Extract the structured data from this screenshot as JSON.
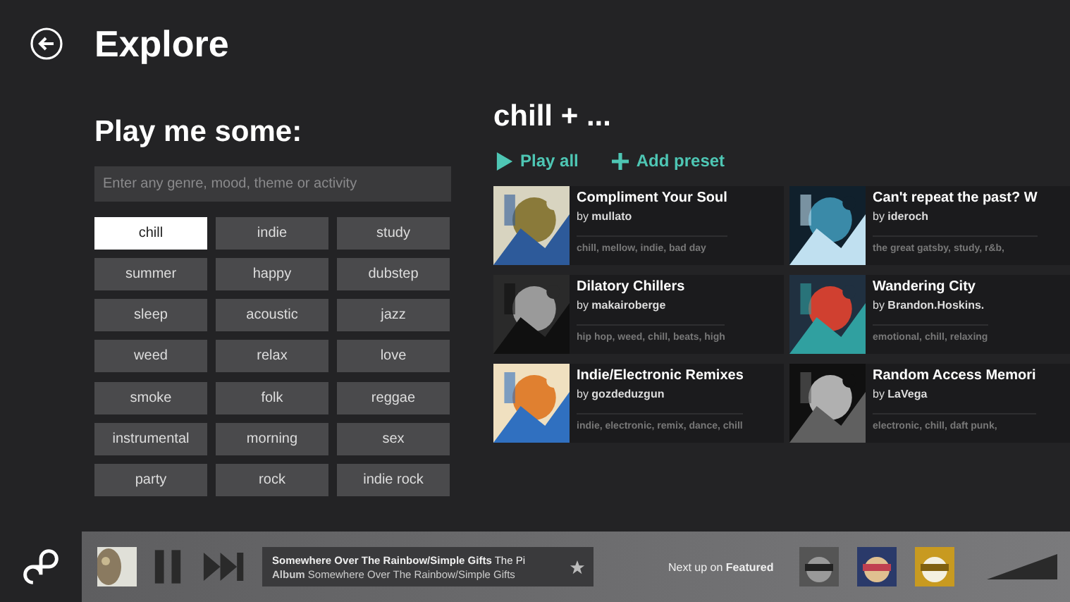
{
  "header": {
    "title": "Explore"
  },
  "search": {
    "heading": "Play me some:",
    "placeholder": "Enter any genre, mood, theme or activity"
  },
  "tags": [
    {
      "label": "chill",
      "selected": true
    },
    {
      "label": "indie",
      "selected": false
    },
    {
      "label": "study",
      "selected": false
    },
    {
      "label": "summer",
      "selected": false
    },
    {
      "label": "happy",
      "selected": false
    },
    {
      "label": "dubstep",
      "selected": false
    },
    {
      "label": "sleep",
      "selected": false
    },
    {
      "label": "acoustic",
      "selected": false
    },
    {
      "label": "jazz",
      "selected": false
    },
    {
      "label": "weed",
      "selected": false
    },
    {
      "label": "relax",
      "selected": false
    },
    {
      "label": "love",
      "selected": false
    },
    {
      "label": "smoke",
      "selected": false
    },
    {
      "label": "folk",
      "selected": false
    },
    {
      "label": "reggae",
      "selected": false
    },
    {
      "label": "instrumental",
      "selected": false
    },
    {
      "label": "morning",
      "selected": false
    },
    {
      "label": "sex",
      "selected": false
    },
    {
      "label": "party",
      "selected": false
    },
    {
      "label": "rock",
      "selected": false
    },
    {
      "label": "indie rock",
      "selected": false
    }
  ],
  "results": {
    "heading": "chill + ...",
    "actions": [
      "Play all",
      "Add preset"
    ],
    "mixes": [
      {
        "title": "Compliment Your Soul",
        "by": "by",
        "author": "mullato",
        "tags": "chill, mellow, indie, bad day"
      },
      {
        "title": "Can't repeat the past? W",
        "by": "by",
        "author": "ideroch",
        "tags": "the great gatsby, study, r&b,"
      },
      {
        "title": "Dilatory Chillers",
        "by": "by",
        "author": "makairoberge",
        "tags": "hip hop, weed, chill, beats, high"
      },
      {
        "title": "Wandering City",
        "by": "by",
        "author": "Brandon.Hoskins.",
        "tags": "emotional, chill, relaxing"
      },
      {
        "title": "Indie/Electronic Remixes",
        "by": "by",
        "author": "gozdeduzgun",
        "tags": "indie, electronic, remix, dance, chill"
      },
      {
        "title": "Random Access Memori",
        "by": "by",
        "author": "LaVega",
        "tags": "electronic, chill, daft punk,"
      }
    ]
  },
  "player": {
    "track": "Somewhere Over The Rainbow/Simple Gifts",
    "artist": "The Pi",
    "album_label": "Album",
    "album": "Somewhere Over The Rainbow/Simple Gifts",
    "next_label": "Next up on",
    "next_source": "Featured"
  }
}
